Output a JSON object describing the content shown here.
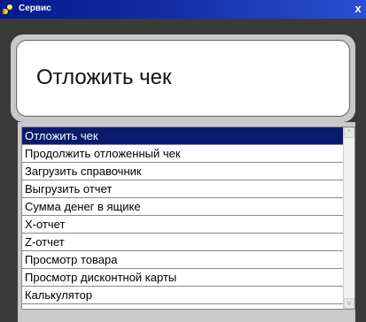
{
  "window": {
    "title": "Сервис",
    "close_glyph": "x"
  },
  "header": {
    "title": "Отложить чек"
  },
  "list": {
    "items": [
      "Отложить чек",
      "Продолжить отложенный чек",
      "Загрузить справочник",
      "Выгрузить отчет",
      "Сумма денег в ящике",
      "X-отчет",
      "Z-отчет",
      "Просмотр товара",
      "Просмотр дисконтной карты",
      "Калькулятор"
    ],
    "selected_index": 0
  },
  "scrollbar": {
    "up_glyph": "^",
    "down_glyph": "v"
  },
  "colors": {
    "title_bar": "#061a8c",
    "selection": "#0a1b6e",
    "panel": "#3a3a3a",
    "frame": "#c9c9c9"
  }
}
